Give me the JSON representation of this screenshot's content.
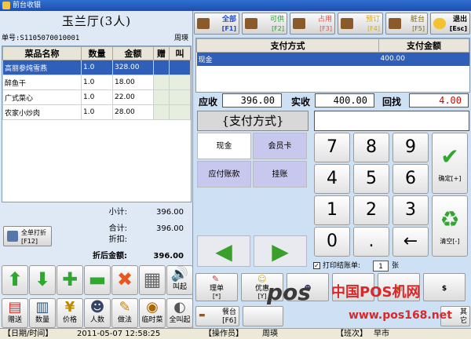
{
  "window": {
    "title": "前台收银"
  },
  "order": {
    "room": "玉兰厅(3人)",
    "number_label": "单号:",
    "number": "S1105070010001",
    "waiter": "周瑛",
    "columns": [
      "菜品名称",
      "数量",
      "金额",
      "赠",
      "叫"
    ],
    "items": [
      {
        "name": "高丽参炖雪燕",
        "qty": "1.0",
        "amount": "328.00"
      },
      {
        "name": "醉鱼干",
        "qty": "1.0",
        "amount": "18.00"
      },
      {
        "name": "广式菜心",
        "qty": "1.0",
        "amount": "22.00"
      },
      {
        "name": "农家小炒肉",
        "qty": "1.0",
        "amount": "28.00"
      }
    ],
    "subtotal_label": "小计:",
    "subtotal": "396.00",
    "total_label": "合计:",
    "total": "396.00",
    "discount_label": "折扣:",
    "after_discount_label": "折后金额:",
    "after_discount": "396.00",
    "print_all_label": "全单打折",
    "print_all_key": "[F12]"
  },
  "left_tools_row1": [
    {
      "icon": "arrow-up-icon",
      "label": ""
    },
    {
      "icon": "arrow-down-icon",
      "label": ""
    },
    {
      "icon": "plus-icon",
      "label": ""
    },
    {
      "icon": "minus-icon",
      "label": ""
    },
    {
      "icon": "delete-x-icon",
      "label": ""
    },
    {
      "icon": "calculator-icon",
      "label": ""
    },
    {
      "icon": "speaker-icon",
      "label": "叫起"
    }
  ],
  "left_tools_row2": [
    {
      "icon": "gift-icon",
      "label": "赠送"
    },
    {
      "icon": "quantity-icon",
      "label": "数量"
    },
    {
      "icon": "price-icon",
      "label": "价格"
    },
    {
      "icon": "people-icon",
      "label": "人数"
    },
    {
      "icon": "method-icon",
      "label": "做法"
    },
    {
      "icon": "temp-dish-icon",
      "label": "临时菜"
    },
    {
      "icon": "all-call-icon",
      "label": "全叫起"
    }
  ],
  "tabs": [
    {
      "label": "全部",
      "key": "[F1]",
      "color": "#1f4fd0"
    },
    {
      "label": "可供",
      "key": "[F2]",
      "color": "#2a9a2a"
    },
    {
      "label": "占用",
      "key": "[F3]",
      "color": "#e0524a"
    },
    {
      "label": "预订",
      "key": "[F4]",
      "color": "#e0a800"
    },
    {
      "label": "脏台",
      "key": "[F5]",
      "color": "#7a6a00"
    },
    {
      "label": "退出",
      "key": "[Esc]",
      "color": "#000000"
    }
  ],
  "payment": {
    "col_method": "支付方式",
    "col_amount": "支付金额",
    "row_method": "现金",
    "row_amount": "400.00",
    "receivable_label": "应收",
    "receivable": "396.00",
    "received_label": "实收",
    "received": "400.00",
    "change_label": "回找",
    "change": "4.00",
    "method_header": "{支付方式}",
    "methods": [
      "现金",
      "会员卡",
      "应付账款",
      "挂账"
    ]
  },
  "keypad": {
    "keys": [
      "7",
      "8",
      "9",
      "4",
      "5",
      "6",
      "1",
      "2",
      "3",
      "0",
      ".",
      "←"
    ],
    "confirm_label": "确定[+]",
    "clear_label": "清空[-]"
  },
  "print_option": {
    "label": "打印结账单:",
    "count": "1",
    "unit": "张",
    "check": "✓"
  },
  "bottom_buttons": [
    {
      "label": "理单",
      "key": "[*]"
    },
    {
      "label": "优惠",
      "key": "[Y]"
    },
    {
      "label": "",
      "key": ""
    },
    {
      "label": "",
      "key": ""
    },
    {
      "label": "",
      "key": ""
    },
    {
      "label": "",
      "key": ""
    }
  ],
  "nav": [
    {
      "label": "餐台",
      "key": "[F6]"
    },
    {
      "label": "其它",
      "key": ""
    }
  ],
  "watermark": {
    "brand": "pos",
    "name": "中国POS机网",
    "url": "www.pos168.net"
  },
  "status": {
    "datetime_label": "【日期/时间】",
    "datetime": "2011-05-07 12:58:25",
    "operator_label": "【操作员】",
    "operator": "周瑛",
    "shift_label": "【班次】",
    "shift": "早市"
  }
}
